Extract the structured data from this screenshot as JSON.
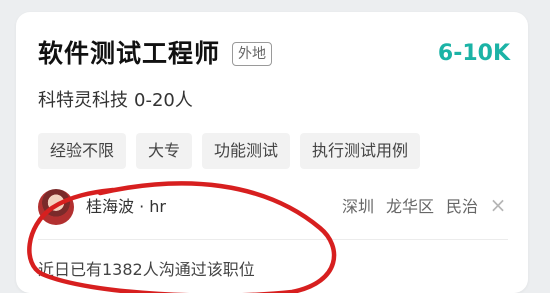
{
  "job": {
    "title": "软件测试工程师",
    "remote_badge": "外地",
    "salary": "6-10K",
    "company_name": "科特灵科技",
    "company_size": "0-20人",
    "tags": [
      "经验不限",
      "大专",
      "功能测试",
      "执行测试用例"
    ]
  },
  "recruiter": {
    "name": "桂海波 · hr",
    "location": [
      "深圳",
      "龙华区",
      "民治"
    ],
    "close_icon": "close-icon"
  },
  "stats": {
    "contact_text": "近日已有1382人沟通过该职位"
  },
  "colors": {
    "accent": "#1bb3a6",
    "annotation": "#d71f1f"
  }
}
